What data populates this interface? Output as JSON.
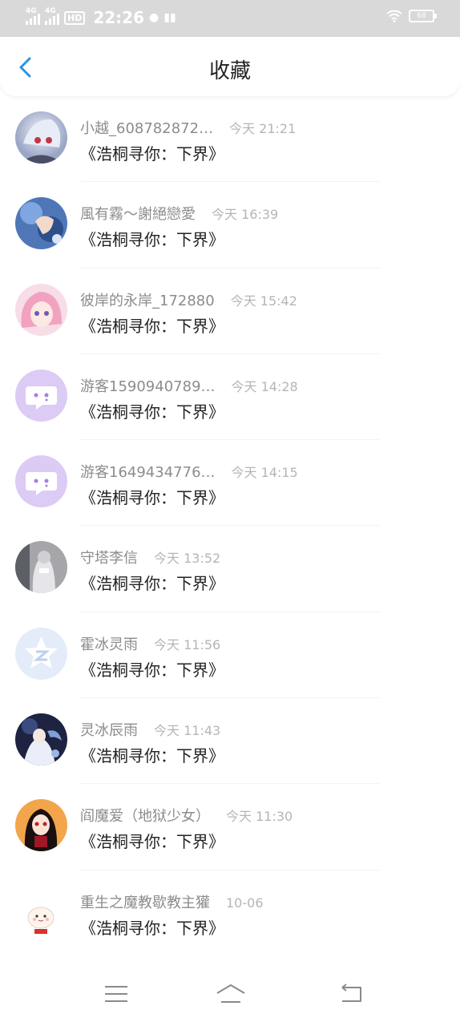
{
  "statusbar": {
    "network1": "4G",
    "network2": "4G",
    "hd": "HD",
    "time": "22:26",
    "battery": "68"
  },
  "header": {
    "title": "收藏"
  },
  "items": [
    {
      "name": "小越_608782872…",
      "time": "今天 21:21",
      "content": "《浩桐寻你：下界》",
      "avatar": "anime-white-hair"
    },
    {
      "name": "風有霧～謝絕戀愛",
      "time": "今天 16:39",
      "content": "《浩桐寻你：下界》",
      "avatar": "anime-blue"
    },
    {
      "name": "彼岸的永岸_172880",
      "time": "今天 15:42",
      "content": "《浩桐寻你：下界》",
      "avatar": "anime-pink"
    },
    {
      "name": "游客1590940789…",
      "time": "今天 14:28",
      "content": "《浩桐寻你：下界》",
      "avatar": "chat-default"
    },
    {
      "name": "游客1649434776…",
      "time": "今天 14:15",
      "content": "《浩桐寻你：下界》",
      "avatar": "chat-default"
    },
    {
      "name": "守塔李信",
      "time": "今天 13:52",
      "content": "《浩桐寻你：下界》",
      "avatar": "gray-photo"
    },
    {
      "name": "霍冰灵雨",
      "time": "今天 11:56",
      "content": "《浩桐寻你：下界》",
      "avatar": "qq-zone-logo"
    },
    {
      "name": "灵冰辰雨",
      "time": "今天 11:43",
      "content": "《浩桐寻你：下界》",
      "avatar": "anime-dark"
    },
    {
      "name": "阎魔爱（地狱少女）",
      "time": "今天 11:30",
      "content": "《浩桐寻你：下界》",
      "avatar": "anime-red"
    },
    {
      "name": "重生之魔教歇教主獾",
      "time": "10-06",
      "content": "《浩桐寻你：下界》",
      "avatar": "cartoon-bun"
    }
  ],
  "colors": {
    "accent": "#2a93e0",
    "chat_bg": "#d9c7f3",
    "chat_fg": "#a77fe0"
  },
  "navbar": {
    "icons": [
      "menu-icon",
      "home-icon",
      "back-nav-icon"
    ]
  }
}
